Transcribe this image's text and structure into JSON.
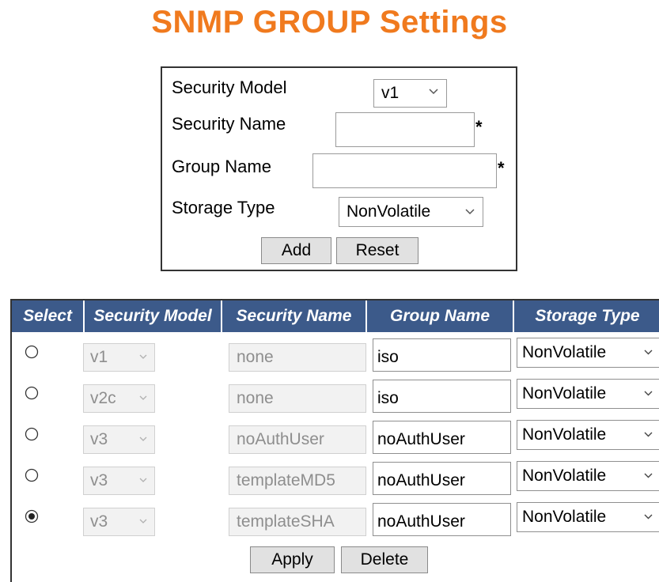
{
  "page": {
    "title": "SNMP GROUP Settings"
  },
  "form": {
    "security_model_label": "Security Model",
    "security_model_value": "v1",
    "security_name_label": "Security Name",
    "security_name_value": "",
    "group_name_label": "Group Name",
    "group_name_value": "",
    "storage_type_label": "Storage Type",
    "storage_type_value": "NonVolatile",
    "required_mark": "*",
    "add_label": "Add",
    "reset_label": "Reset"
  },
  "table": {
    "headers": [
      "Select",
      "Security Model",
      "Security Name",
      "Group Name",
      "Storage Type"
    ],
    "rows": [
      {
        "selected": false,
        "security_model": "v1",
        "security_name": "none",
        "group_name": "iso",
        "storage_type": "NonVolatile"
      },
      {
        "selected": false,
        "security_model": "v2c",
        "security_name": "none",
        "group_name": "iso",
        "storage_type": "NonVolatile"
      },
      {
        "selected": false,
        "security_model": "v3",
        "security_name": "noAuthUser",
        "group_name": "noAuthUser",
        "storage_type": "NonVolatile"
      },
      {
        "selected": false,
        "security_model": "v3",
        "security_name": "templateMD5",
        "group_name": "noAuthUser",
        "storage_type": "NonVolatile"
      },
      {
        "selected": true,
        "security_model": "v3",
        "security_name": "templateSHA",
        "group_name": "noAuthUser",
        "storage_type": "NonVolatile"
      }
    ],
    "apply_label": "Apply",
    "delete_label": "Delete"
  },
  "colors": {
    "title": "#f07a1e",
    "header_bg": "#3c5a8a",
    "header_text": "#ffffff"
  },
  "icons": {
    "select_arrow": "chevron-down-icon",
    "radio_unchecked": "radio-unchecked-icon",
    "radio_checked": "radio-checked-icon"
  }
}
